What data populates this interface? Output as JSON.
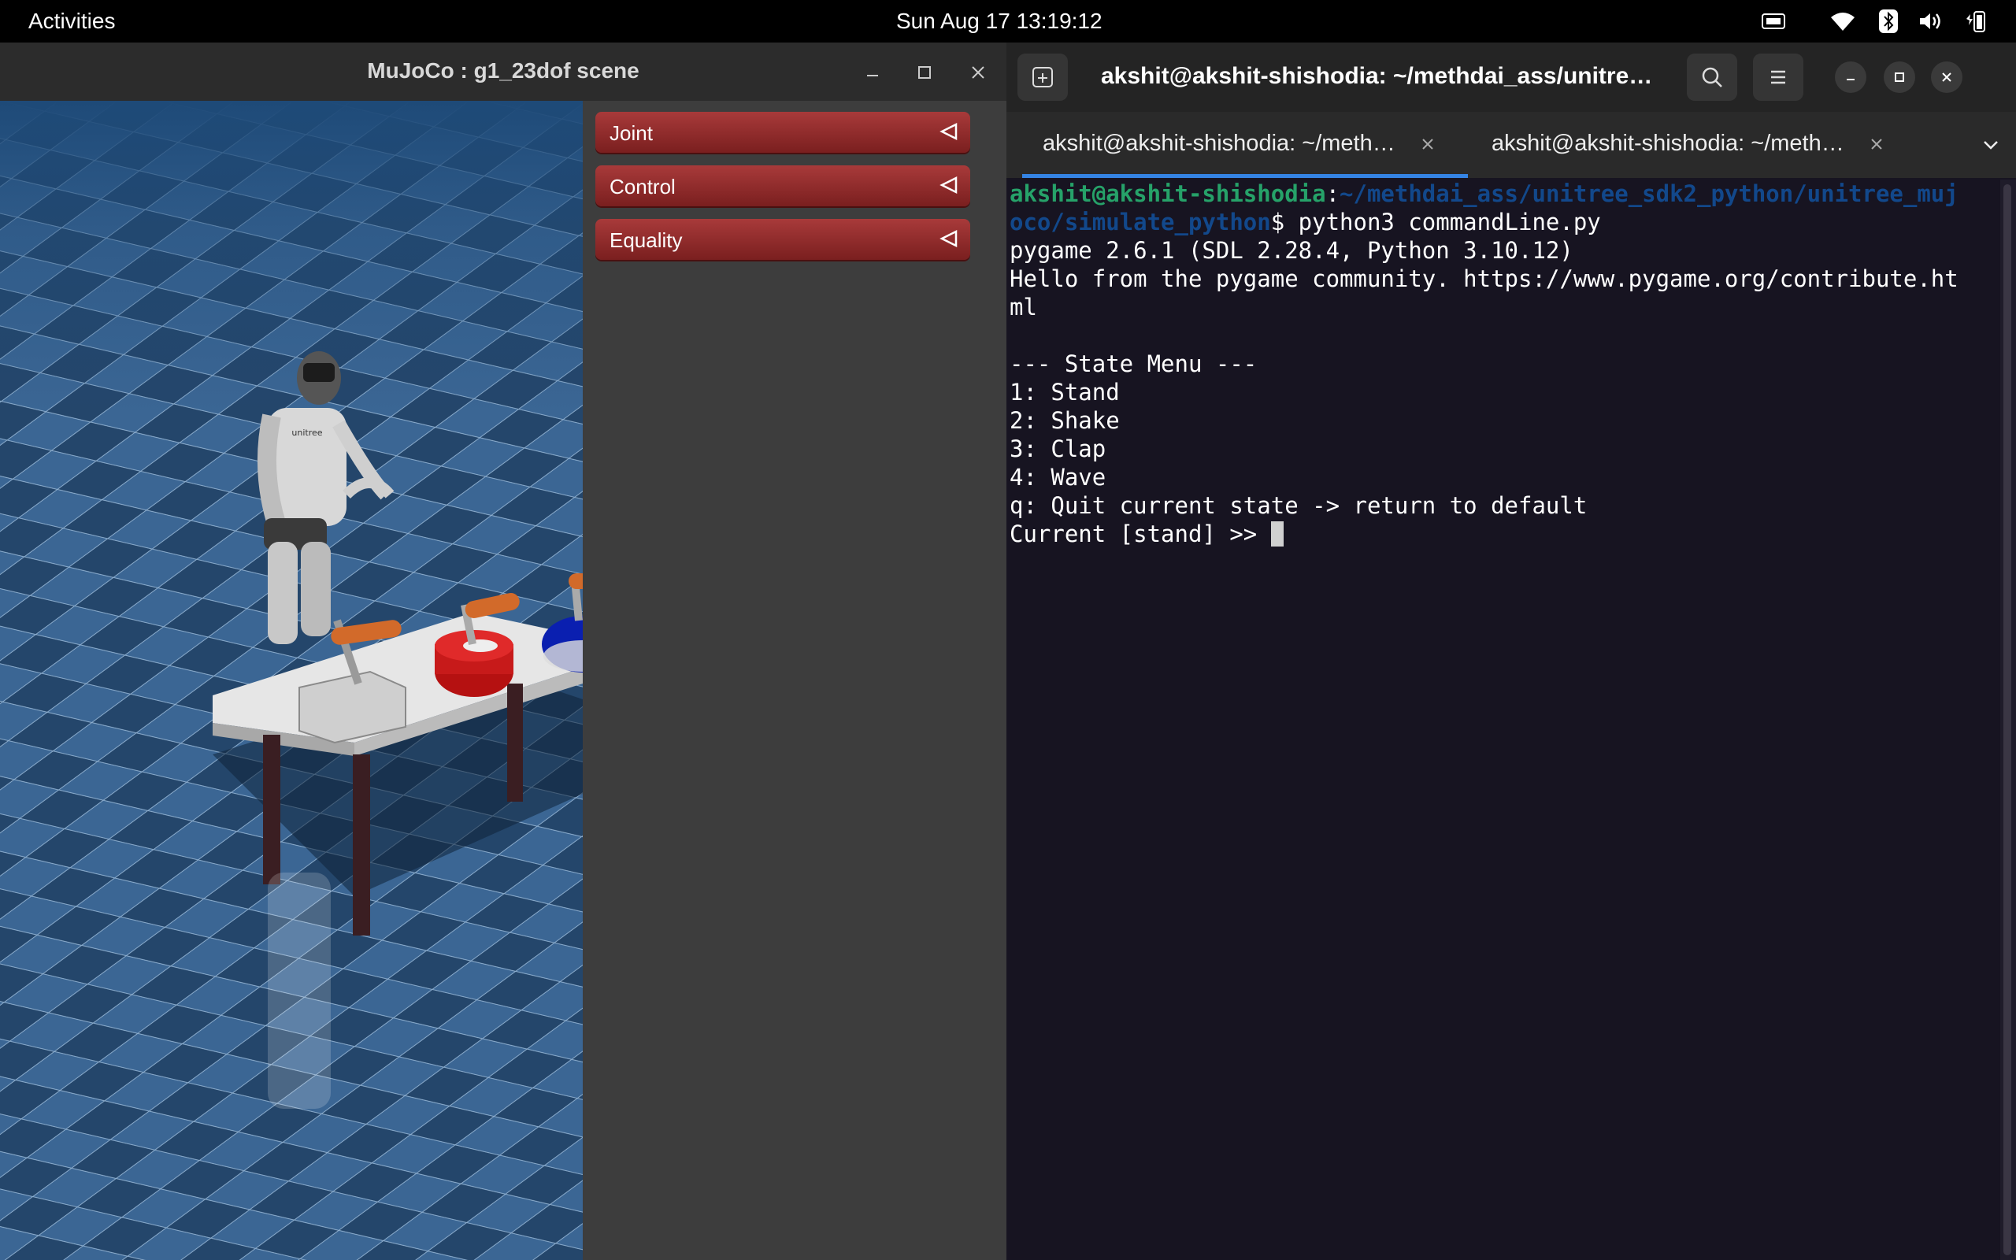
{
  "topbar": {
    "activities": "Activities",
    "clock": "Sun Aug 17  13:19:12",
    "tray_icons": [
      "screen-share-icon",
      "wifi-icon",
      "bluetooth-icon",
      "volume-icon",
      "battery-icon"
    ]
  },
  "mujoco": {
    "title": "MuJoCo : g1_23dof scene",
    "menus": [
      {
        "label": "Joint"
      },
      {
        "label": "Control"
      },
      {
        "label": "Equality"
      }
    ],
    "colors": {
      "menu": "#8e2b2b",
      "floor_a": "#24466b",
      "floor_b": "#3b6694"
    }
  },
  "terminal": {
    "title": "akshit@akshit-shishodia: ~/methdai_ass/unitre…",
    "tabs": [
      {
        "label": "akshit@akshit-shishodia: ~/meth…",
        "active": true
      },
      {
        "label": "akshit@akshit-shishodia: ~/meth…",
        "active": false
      }
    ],
    "prompt_user": "akshit@akshit-shishodia",
    "prompt_sep": ":",
    "prompt_path_1": "~/methdai_ass/unitree_sdk2_python/unitree_muj",
    "prompt_path_2": "oco/simulate_python",
    "prompt_cmd": "$ python3 commandLine.py",
    "output": [
      "pygame 2.6.1 (SDL 2.28.4, Python 3.10.12)",
      "Hello from the pygame community. https://www.pygame.org/contribute.ht",
      "ml",
      "",
      "--- State Menu ---",
      "1: Stand",
      "2: Shake",
      "3: Clap",
      "4: Wave",
      "q: Quit current state -> return to default"
    ],
    "current_prompt": "Current [stand] >> ",
    "colors": {
      "bg": "#171421",
      "user": "#26a269",
      "path": "#12488b",
      "accent": "#3584e4"
    }
  }
}
